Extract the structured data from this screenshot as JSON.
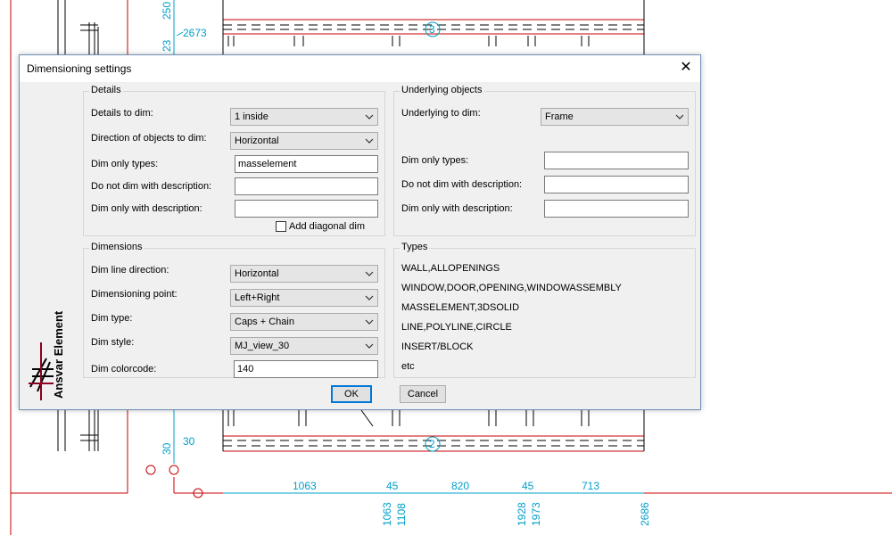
{
  "dialog": {
    "title": "Dimensioning settings",
    "close_glyph": "✕",
    "details": {
      "group_label": "Details",
      "details_to_dim_label": "Details to dim:",
      "details_to_dim_value": "1 inside",
      "direction_label": "Direction of objects to dim:",
      "direction_value": "Horizontal",
      "dim_only_types_label": "Dim only types:",
      "dim_only_types_value": "masselement",
      "not_dim_desc_label": "Do not dim with description:",
      "not_dim_desc_value": "",
      "dim_only_desc_label": "Dim only with description:",
      "dim_only_desc_value": "",
      "add_diagonal_label": "Add diagonal dim",
      "add_diagonal_checked": false
    },
    "underlying": {
      "group_label": "Underlying objects",
      "underlying_to_dim_label": "Underlying to dim:",
      "underlying_to_dim_value": "Frame",
      "dim_only_types_label": "Dim only types:",
      "dim_only_types_value": "",
      "not_dim_desc_label": "Do not dim with description:",
      "not_dim_desc_value": "",
      "dim_only_desc_label": "Dim only with description:",
      "dim_only_desc_value": ""
    },
    "dimensions": {
      "group_label": "Dimensions",
      "line_direction_label": "Dim line direction:",
      "line_direction_value": "Horizontal",
      "point_label": "Dimensioning point:",
      "point_value": "Left+Right",
      "type_label": "Dim type:",
      "type_value": "Caps + Chain",
      "style_label": "Dim style:",
      "style_value": "MJ_view_30",
      "colorcode_label": "Dim colorcode:",
      "colorcode_value": "140"
    },
    "types": {
      "group_label": "Types",
      "items": [
        "WALL,ALLOPENINGS",
        "WINDOW,DOOR,OPENING,WINDOWASSEMBLY",
        "MASSELEMENT,3DSOLID",
        "LINE,POLYLINE,CIRCLE",
        "INSERT/BLOCK",
        "etc"
      ]
    },
    "ok_label": "OK",
    "cancel_label": "Cancel",
    "logo_text": "Ansvar Element"
  },
  "drawing": {
    "dims_top": [
      "250",
      "2673",
      "23"
    ],
    "axis_top": "3",
    "axis_bottom": "2",
    "dims_left": [
      "30",
      "30"
    ],
    "dims_bottom": [
      "1063",
      "45",
      "820",
      "45",
      "713"
    ],
    "dims_bottom_vertical": [
      "1063",
      "1108",
      "1928",
      "1973",
      "2686"
    ]
  },
  "colors": {
    "dim_cyan": "#00a0c8",
    "wall_red": "#c80000",
    "accent": "#0078d7"
  }
}
